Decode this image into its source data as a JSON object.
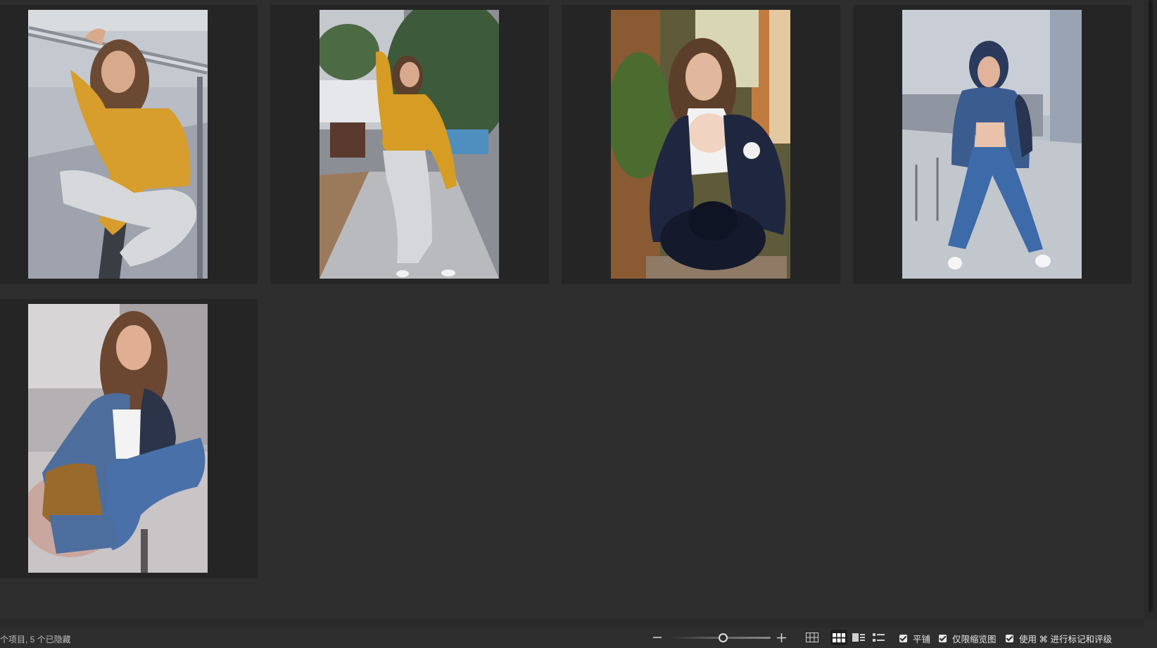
{
  "status": {
    "summary": "个项目, 5 个已隐藏"
  },
  "zoom": {
    "level": 0.53,
    "zoom_out_icon": "minus-icon",
    "zoom_in_icon": "plus-icon"
  },
  "views": [
    {
      "name": "view-grid-large",
      "icon": "grid-icon",
      "active": false
    },
    {
      "name": "view-grid-thumbnails",
      "icon": "thumbnail-grid-icon",
      "active": true
    },
    {
      "name": "view-filmstrip",
      "icon": "filmstrip-icon",
      "active": false
    },
    {
      "name": "view-list",
      "icon": "list-icon",
      "active": false
    }
  ],
  "options": {
    "tile_label": "平铺",
    "thumbnails_only_label": "仅限缩览图",
    "cmd_rating_label": "使用 ⌘ 进行标记和评级"
  },
  "photos": [
    {
      "subject": "yellow sweater on stairs"
    },
    {
      "subject": "yellow sweater walking"
    },
    {
      "subject": "striped jacket with hat"
    },
    {
      "subject": "denim hoodie standing"
    },
    {
      "subject": "denim jacket crouching"
    }
  ],
  "colors": {
    "background": "#2e2e2e",
    "cell": "#252525",
    "text": "#e6e6e6"
  }
}
